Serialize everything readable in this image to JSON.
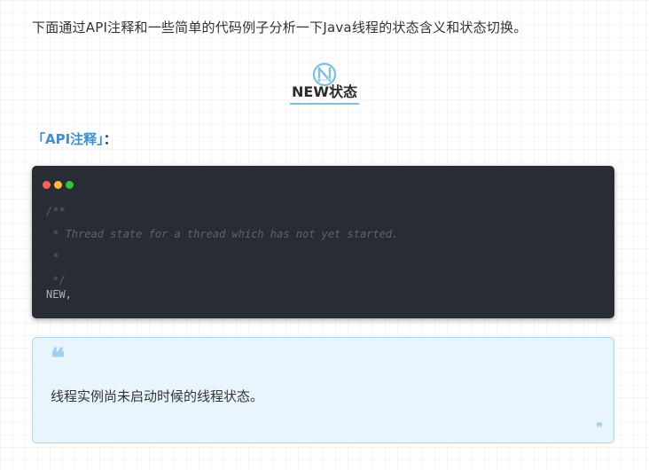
{
  "intro": {
    "text": "下面通过API注释和一些简单的代码例子分析一下Java线程的状态含义和状态切换。"
  },
  "section": {
    "title": "NEW状态",
    "icon": "heading-badge-icon",
    "accent_color": "#7dbfe0"
  },
  "api_note": {
    "label": "「API注释」",
    "colon": "：",
    "color": "#3d8fd1"
  },
  "code_block": {
    "window_dots": [
      "close-dot",
      "minimize-dot",
      "maximize-dot"
    ],
    "background": "#282c34",
    "lines": [
      "/**",
      " * Thread state for a thread which has not yet started.",
      " *",
      " */",
      "NEW,"
    ]
  },
  "quote": {
    "open_mark": "❝",
    "text": "线程实例尚未启动时候的线程状态。",
    "close_mark": "❞",
    "background": "#e9f5fd"
  }
}
